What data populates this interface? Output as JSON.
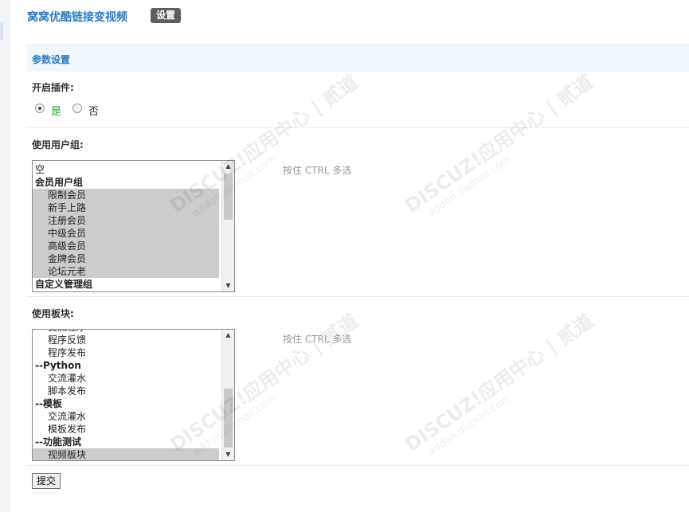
{
  "header": {
    "title": "窝窝优酷链接变视频",
    "badge": "设置"
  },
  "section": {
    "title": "参数设置"
  },
  "plugin_toggle": {
    "label": "开启插件:",
    "yes": "是",
    "no": "否",
    "selected": "yes"
  },
  "user_groups": {
    "label": "使用用户组:",
    "hint": "按住 CTRL 多选",
    "options": [
      {
        "text": "空",
        "kind": "item",
        "selected": false
      },
      {
        "text": "会员用户组",
        "kind": "group",
        "selected": false
      },
      {
        "text": "限制会员",
        "kind": "child",
        "selected": true
      },
      {
        "text": "新手上路",
        "kind": "child",
        "selected": true
      },
      {
        "text": "注册会员",
        "kind": "child",
        "selected": true
      },
      {
        "text": "中级会员",
        "kind": "child",
        "selected": true
      },
      {
        "text": "高级会员",
        "kind": "child",
        "selected": true
      },
      {
        "text": "金牌会员",
        "kind": "child",
        "selected": true
      },
      {
        "text": "论坛元老",
        "kind": "child",
        "selected": true
      },
      {
        "text": "自定义管理组",
        "kind": "group",
        "selected": false
      }
    ]
  },
  "forums": {
    "label": "使用板块:",
    "hint": "按住 CTRL 多选",
    "options": [
      {
        "text": "交流程序",
        "kind": "child",
        "selected": false
      },
      {
        "text": "程序反馈",
        "kind": "child",
        "selected": false
      },
      {
        "text": "程序发布",
        "kind": "child",
        "selected": false
      },
      {
        "text": "--Python",
        "kind": "group",
        "selected": false
      },
      {
        "text": "交流灌水",
        "kind": "child",
        "selected": false
      },
      {
        "text": "脚本发布",
        "kind": "child",
        "selected": false
      },
      {
        "text": "--模板",
        "kind": "group",
        "selected": false
      },
      {
        "text": "交流灌水",
        "kind": "child",
        "selected": false
      },
      {
        "text": "模板发布",
        "kind": "child",
        "selected": false
      },
      {
        "text": "--功能测试",
        "kind": "group",
        "selected": false
      },
      {
        "text": "视频板块",
        "kind": "child",
        "selected": true
      }
    ]
  },
  "submit": {
    "label": "提交"
  },
  "watermark": {
    "text": "DISCUZ!应用中心 | 贰道",
    "sub": "addon.dismall.com"
  },
  "colors": {
    "accent": "#2b7cc4",
    "section_bg": "#f0f7fd",
    "selected_bg": "#cccccc",
    "badge_bg": "#5f5f5f",
    "yes_text": "#2aa52a"
  }
}
